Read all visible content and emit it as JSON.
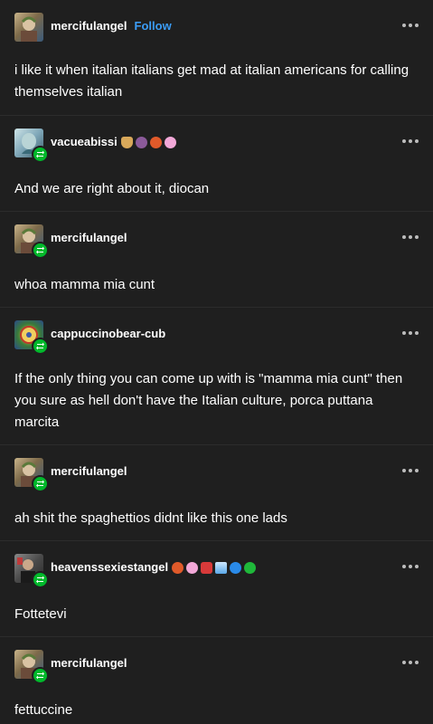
{
  "posts": [
    {
      "username": "mercifulangel",
      "follow_label": "Follow",
      "avatar": "tumblr-avatar-icon",
      "text": "i like it when italian italians get mad at italian americans for calling themselves italian"
    },
    {
      "username": "vacueabissi",
      "avatar": "tumblr-avatar-icon",
      "badges": [
        "hat-badge-icon",
        "octopus-badge-icon",
        "pumpkin-badge-icon",
        "flower-badge-icon"
      ],
      "text": "And we are right about it, diocan"
    },
    {
      "username": "mercifulangel",
      "avatar": "tumblr-avatar-icon",
      "text": "whoa mamma mia cunt"
    },
    {
      "username": "cappuccinobear-cub",
      "avatar": "tumblr-avatar-icon",
      "text": "If the only thing you can come up with is \"mamma mia cunt\" then you sure as hell don't have the Italian culture, porca puttana marcita"
    },
    {
      "username": "mercifulangel",
      "avatar": "tumblr-avatar-icon",
      "text": "ah shit the spaghettios didnt like this one lads"
    },
    {
      "username": "heavenssexiestangel",
      "avatar": "tumblr-avatar-icon",
      "badges": [
        "pumpkin-badge-icon",
        "octopus-badge-icon",
        "shield-badge-icon",
        "wing-badge-icon",
        "verified-badge-icon",
        "check-badge-icon"
      ],
      "text": "Fottetevi"
    },
    {
      "username": "mercifulangel",
      "avatar": "tumblr-avatar-icon",
      "text": "fettuccine"
    }
  ],
  "colors": {
    "background": "#1f1f1f",
    "divider": "#2c2c2c",
    "follow": "#3b9cf6",
    "reblog_badge": "#00b82b"
  },
  "icons": {
    "more": "more-options-icon",
    "reblog": "reblog-icon"
  }
}
